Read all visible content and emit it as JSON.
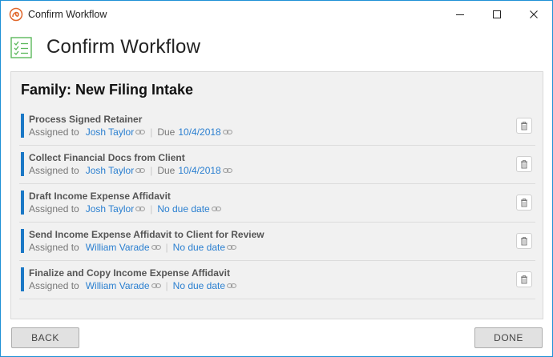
{
  "window": {
    "title": "Confirm Workflow",
    "controls": [
      "minimize-icon",
      "maximize-icon",
      "close-icon"
    ]
  },
  "header": {
    "icon": "checklist-icon",
    "title": "Confirm Workflow"
  },
  "panel": {
    "title": "Family: New Filing Intake",
    "assigned_label": "Assigned to",
    "due_label": "Due",
    "tasks": [
      {
        "name": "Process Signed Retainer",
        "assignee": "Josh Taylor",
        "due_prefix": "Due",
        "due": "10/4/2018"
      },
      {
        "name": "Collect Financial Docs from Client",
        "assignee": "Josh Taylor",
        "due_prefix": "Due",
        "due": "10/4/2018"
      },
      {
        "name": "Draft Income Expense Affidavit",
        "assignee": "Josh Taylor",
        "due_prefix": "",
        "due": "No due date"
      },
      {
        "name": "Send Income Expense Affidavit to Client for Review",
        "assignee": "William Varade",
        "due_prefix": "",
        "due": "No due date"
      },
      {
        "name": "Finalize and Copy Income Expense Affidavit",
        "assignee": "William Varade",
        "due_prefix": "",
        "due": "No due date"
      }
    ]
  },
  "footer": {
    "back_label": "BACK",
    "done_label": "DONE"
  },
  "colors": {
    "accent": "#1b78c6",
    "link": "#2a7fd0",
    "window_border": "#1e90d6",
    "header_icon": "#5cb85c"
  }
}
